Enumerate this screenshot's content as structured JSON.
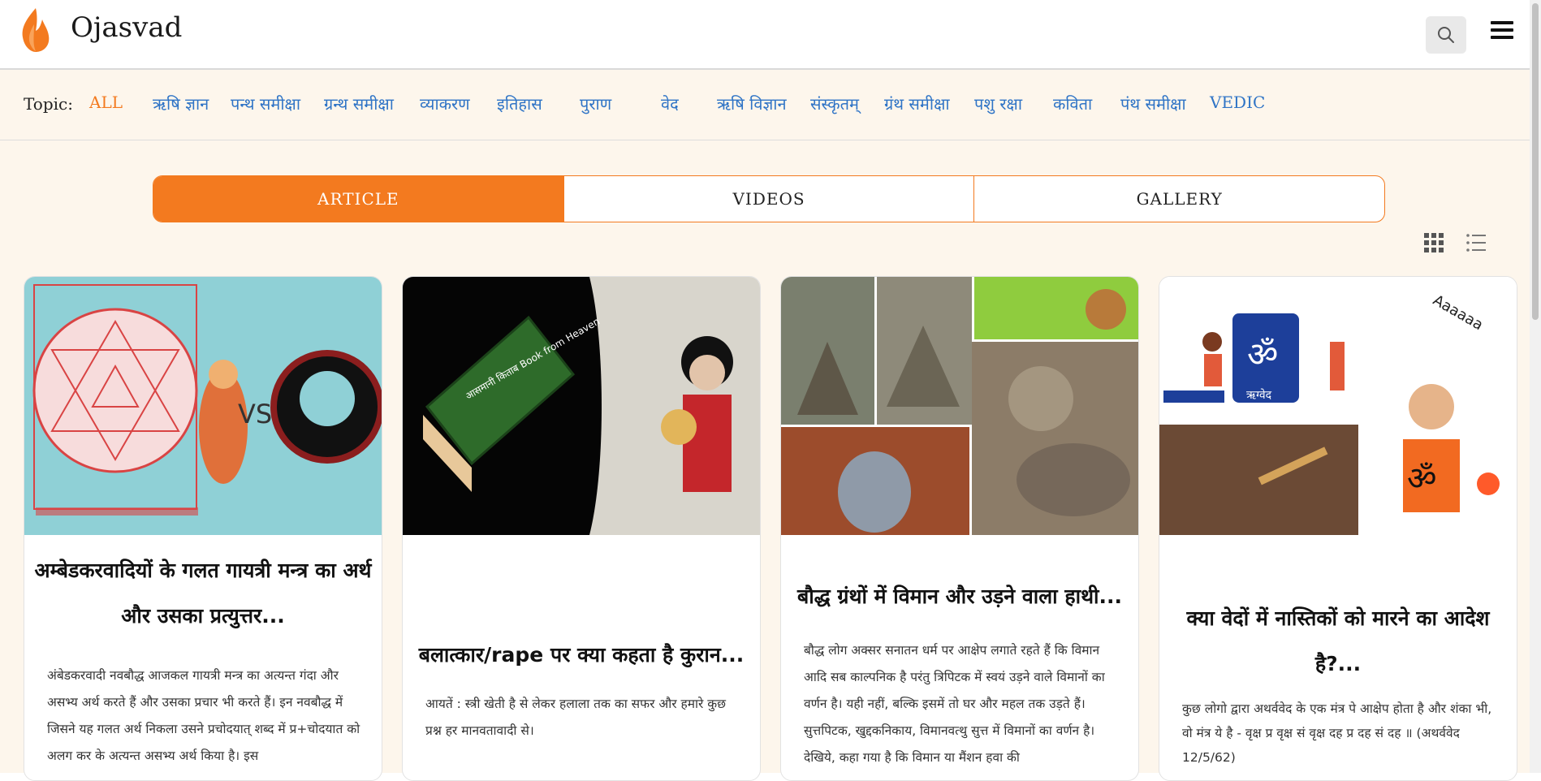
{
  "header": {
    "brand": "Ojasvad",
    "logo_icon": "flame-icon",
    "accent_color": "#f37a1f",
    "search_icon": "search-icon",
    "menu_icon": "hamburger-menu-icon"
  },
  "topics": {
    "label": "Topic:",
    "items": [
      {
        "label": "ALL",
        "active": true
      },
      {
        "label": "ऋषि ज्ञान"
      },
      {
        "label": "पन्थ समीक्षा"
      },
      {
        "label": "ग्रन्थ समीक्षा"
      },
      {
        "label": "व्याकरण"
      },
      {
        "label": "इतिहास"
      },
      {
        "label": "पुराण"
      },
      {
        "label": "वेद"
      },
      {
        "label": "ऋषि विज्ञान"
      },
      {
        "label": "संस्कृतम्"
      },
      {
        "label": "ग्रंथ समीक्षा"
      },
      {
        "label": "पशु रक्षा"
      },
      {
        "label": "कविता"
      },
      {
        "label": "पंथ समीक्षा"
      },
      {
        "label": "VEDIC"
      }
    ]
  },
  "tabs": [
    {
      "label": "ARTICLE",
      "active": true
    },
    {
      "label": "VIDEOS"
    },
    {
      "label": "GALLERY"
    }
  ],
  "view_toggle": {
    "grid_icon": "grid-view-icon",
    "list_icon": "list-view-icon",
    "selected": "grid"
  },
  "cards": [
    {
      "title": "अम्बेडकरवादियों के गलत गायत्री मन्त्र का अर्थ और उसका प्रत्युत्तर...",
      "image_text": "VS",
      "excerpt": "अंबेडकरवादी नवबौद्ध आजकल गायत्री मन्त्र का अत्यन्त गंदा और असभ्य अर्थ करते हैं और उसका प्रचार भी करते हैं। इन नवबौद्ध में जिसने यह गलत अर्थ निकला उसने प्रचोदयात् शब्द में प्र+चोदयात को अलग कर के अत्यन्त असभ्य अर्थ किया है। इस"
    },
    {
      "title": "बलात्कार/rape पर क्या कहता है कुरान...",
      "image_text": "आसमानी किताब Book from Heaven",
      "excerpt": "आयतें : स्त्री खेती है से लेकर हलाला तक का सफर और हमारे कुछ प्रश्न हर मानवतावादी से।"
    },
    {
      "title": "बौद्ध ग्रंथों में विमान और उड़ने वाला हाथी...",
      "image_text": "",
      "excerpt": "बौद्ध लोग अक्सर सनातन धर्म पर आक्षेप लगाते रहते हैं कि विमान आदि सब काल्पनिक है परंतु त्रिपिटक में स्वयं उड़ने वाले विमानों का वर्णन है। यही नहीं, बल्कि इसमें तो घर और महल तक उड़ते हैं। सुत्तपिटक, खुद्दकनिकाय, विमानवत्थु सुत्त में विमानों का वर्णन है। देखिये, कहा गया है कि विमान या मैंशन हवा की"
    },
    {
      "title": "क्या वेदों में नास्तिकों को मारने का आदेश है?...",
      "image_text": "ऋग्वेद",
      "image_text_2": "Aaaaaa",
      "excerpt": "कुछ लोगो द्वारा अथर्ववेद के एक मंत्र पे आक्षेप होता है और शंका भी, वो मंत्र ये है - वृक्ष प्र वृक्ष सं वृक्ष दह प्र दह सं दह ॥ (अथर्ववेद 12/5/62)"
    }
  ]
}
